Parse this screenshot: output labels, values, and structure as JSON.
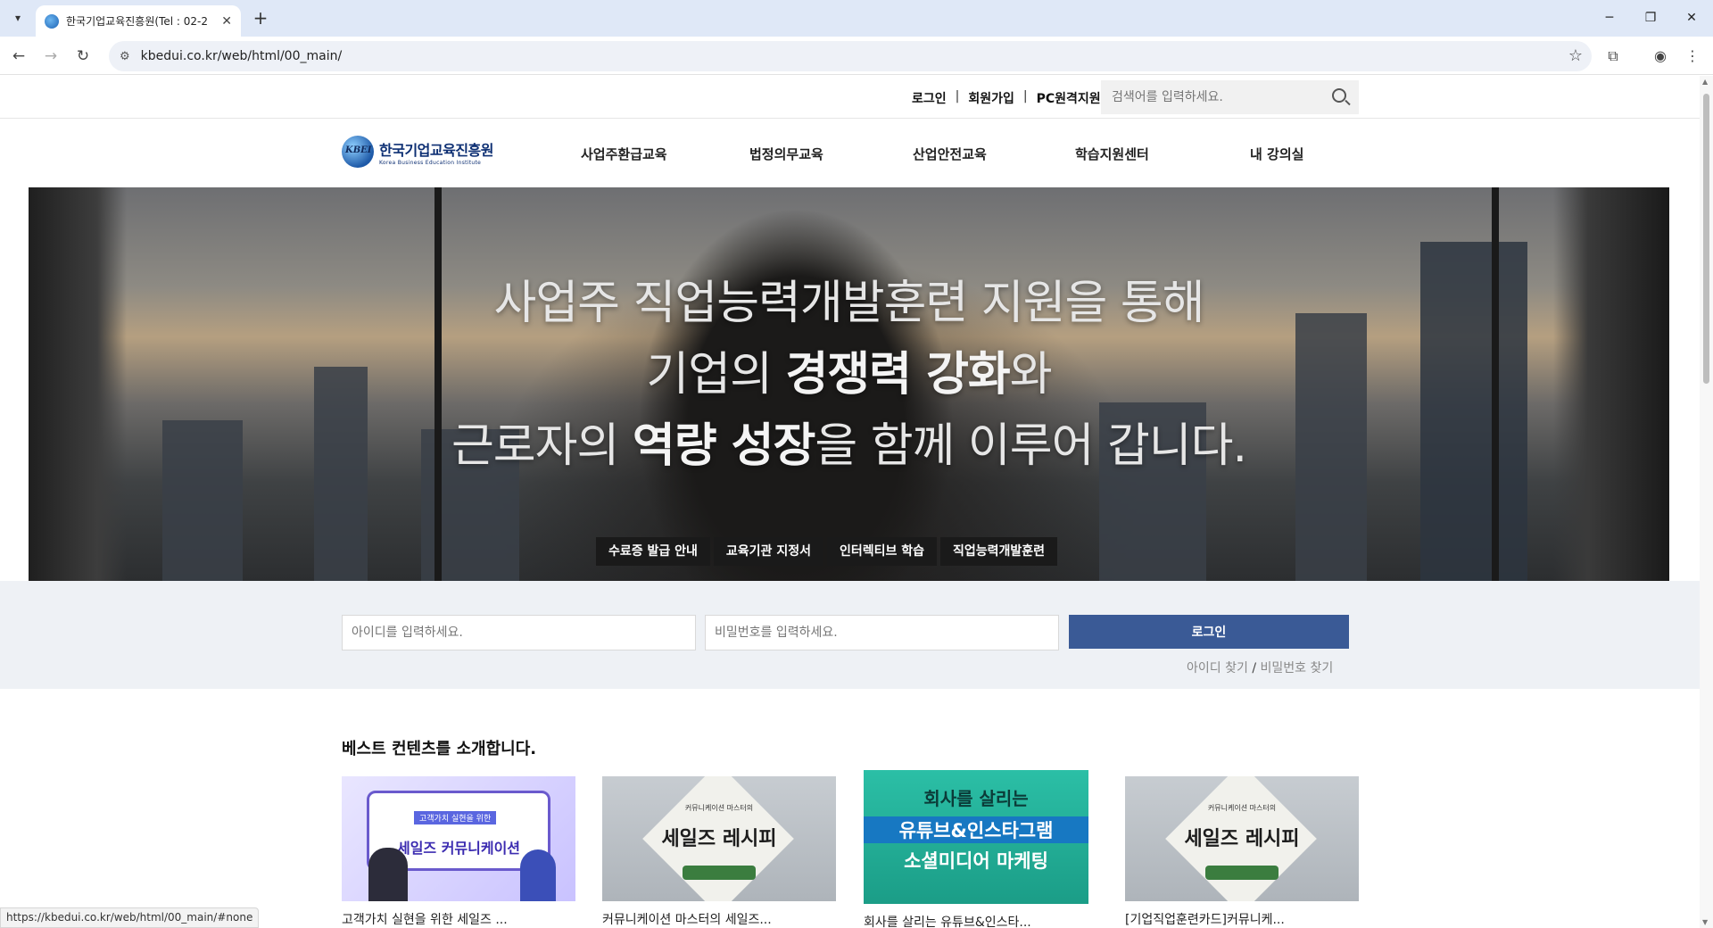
{
  "browser": {
    "tab_title": "한국기업교육진흥원(Tel : 02-2",
    "url": "kbedui.co.kr/web/html/00_main/",
    "status_url": "https://kbedui.co.kr/web/html/00_main/#none"
  },
  "util": {
    "login": "로그인",
    "join": "회원가입",
    "remote": "PC원격지원",
    "sep": "|",
    "search_placeholder": "검색어를 입력하세요."
  },
  "logo": {
    "mark": "KBEI",
    "ko": "한국기업교육진흥원",
    "en": "Korea Business Education Institute"
  },
  "gnb": [
    "사업주환급교육",
    "법정의무교육",
    "산업안전교육",
    "학습지원센터",
    "내 강의실"
  ],
  "hero": {
    "line1": "사업주 직업능력개발훈련 지원을 통해",
    "line2_pre": "기업의 ",
    "line2_bold": "경쟁력 강화",
    "line2_post": "와",
    "line3_pre": "근로자의 ",
    "line3_bold": "역량 성장",
    "line3_post": "을 함께 이루어 갑니다.",
    "tags": [
      "수료증 발급 안내",
      "교육기관 지정서",
      "인터렉티브 학습",
      "직업능력개발훈련"
    ]
  },
  "login_form": {
    "id_placeholder": "아이디를 입력하세요.",
    "pw_placeholder": "비밀번호를 입력하세요.",
    "button": "로그인",
    "find_id": "아이디 찾기",
    "slash": "/",
    "find_pw": "비밀번호 찾기"
  },
  "best": {
    "title": "베스트 컨텐츠를 소개합니다.",
    "cards": [
      {
        "thumb_badge": "고객가치 실현을 위한",
        "thumb_title": "세일즈 커뮤니케이션",
        "caption": "고객가치 실현을 위한 세일즈 ..."
      },
      {
        "thumb_small": "커뮤니케이션 마스터의",
        "thumb_title": "세일즈 레시피",
        "caption": "커뮤니케이션 마스터의 세일즈..."
      },
      {
        "thumb_l1": "회사를 살리는",
        "thumb_l2": "유튜브&인스타그램",
        "thumb_l3": "소셜미디어 마케팅",
        "caption": "회사를 살리는 유튜브&인스타..."
      },
      {
        "thumb_small": "커뮤니케이션 마스터의",
        "thumb_title": "세일즈 레시피",
        "caption": "[기업직업훈련카드]커뮤니케..."
      }
    ]
  },
  "colors": {
    "login_button": "#3a5a96",
    "login_strip": "#eef1f5",
    "tab_bar": "#dfe8f7"
  }
}
